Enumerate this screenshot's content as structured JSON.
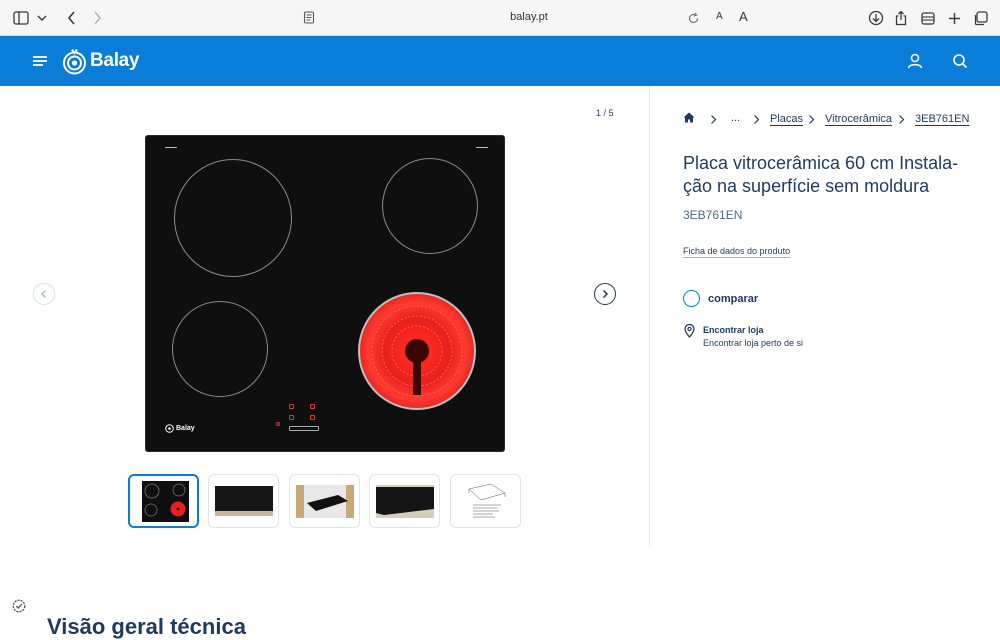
{
  "browser": {
    "url": "balay.pt",
    "text_small": "A",
    "text_large": "A"
  },
  "header": {
    "brand": "Balay"
  },
  "gallery": {
    "counter": "1 / 5",
    "hob_brand": "Balay"
  },
  "breadcrumb": {
    "ellipsis": "...",
    "items": [
      "Placas",
      "Vitrocerâmica",
      "3EB761EN"
    ]
  },
  "product": {
    "title": "Placa vitrocerâmica 60 cm Instala-ção na superfície sem moldura",
    "sku": "3EB761EN",
    "datasheet_link": "Ficha de dados do produto",
    "compare_label": "comparar",
    "store_title": "Encontrar loja",
    "store_subtitle": "Encontrar loja perto de si"
  },
  "section": {
    "heading": "Visão geral técnica"
  },
  "colors": {
    "brand_blue": "#0a7dd8",
    "navy_text": "#1e3a5f",
    "hot_red": "#e8201c"
  }
}
